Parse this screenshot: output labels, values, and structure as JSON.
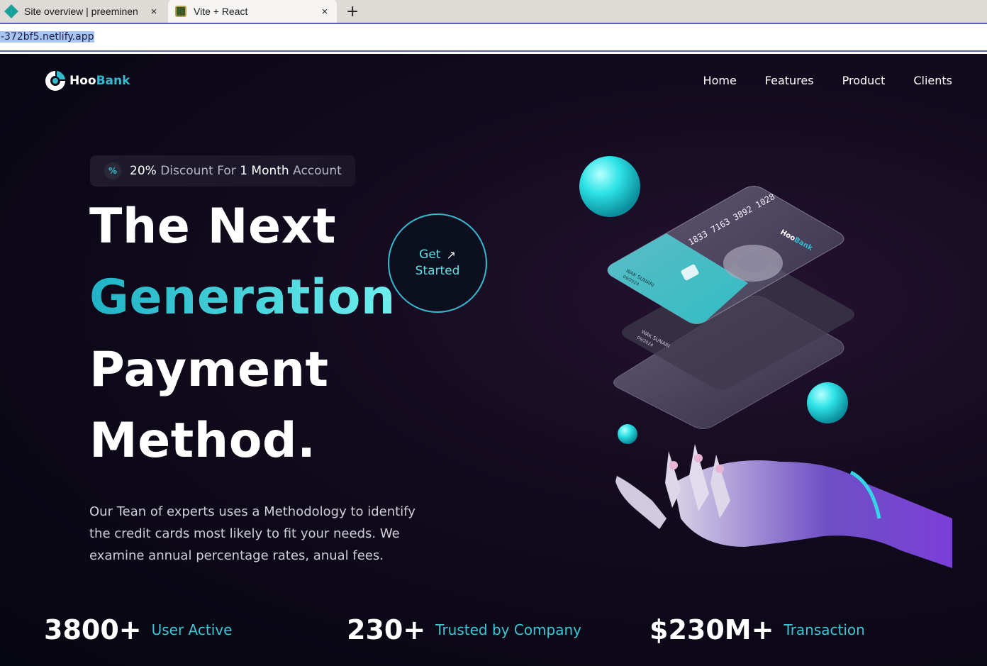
{
  "browser": {
    "tabs": [
      {
        "title": "Site overview | preeminen",
        "active": false
      },
      {
        "title": "Vite + React",
        "active": true
      }
    ],
    "new_tab_label": "+",
    "close_label": "×",
    "url": "-372bf5.netlify.app"
  },
  "brand": {
    "name_part1": "Hoo",
    "name_part2": "Bank",
    "accent": "#33bbcf"
  },
  "nav": {
    "items": [
      "Home",
      "Features",
      "Product",
      "Clients"
    ]
  },
  "hero": {
    "discount": {
      "icon": "%",
      "bold1": "20%",
      "text1": " Discount For ",
      "bold2": "1 Month",
      "text2": " Account"
    },
    "heading_line1": "The Next",
    "heading_line2": "Generation",
    "heading_line3": "Payment",
    "heading_line4": "Method.",
    "cta_line1": "Get",
    "cta_line2": "Started",
    "cta_icon": "arrow-up-right-icon",
    "description": "Our Tean of experts uses a Methodology to identify the credit cards most likely to fit your needs. We examine annual percentage rates, anual fees."
  },
  "illustration": {
    "card_number": "1833 7163 3892 1028",
    "card_holder": "WAK SUNARI",
    "card_expiry": "09/2024",
    "card_brand_part1": "Hoo",
    "card_brand_part2": "Bank"
  },
  "stats": [
    {
      "value": "3800+",
      "label": "User Active"
    },
    {
      "value": "230+",
      "label": "Trusted by Company"
    },
    {
      "value": "$230M+",
      "label": "Transaction"
    }
  ]
}
